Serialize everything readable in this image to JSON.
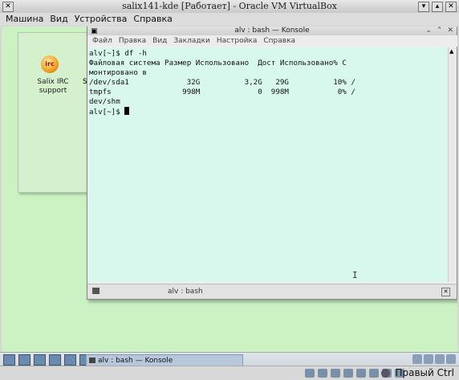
{
  "window": {
    "title": "salix141-kde [Работает] - Oracle VM VirtualBox",
    "controls": [
      "▾",
      "▴",
      "✕"
    ]
  },
  "vb_menu": [
    "Машина",
    "Вид",
    "Устройства",
    "Справка"
  ],
  "desktop_icon": {
    "badge": "irc",
    "label_line1": "Salix IRC",
    "label_line2": "support",
    "peek": "S"
  },
  "konsole": {
    "title": "alv : bash — Konsole",
    "menu": [
      "Файл",
      "Правка",
      "Вид",
      "Закладки",
      "Настройка",
      "Справка"
    ],
    "terminal_lines": [
      "alv[~]$ df -h",
      "Файловая система Размер Использовано  Дост Использовано% С",
      "монтировано в",
      "/dev/sda1             32G          3,2G   29G          10% /",
      "tmpfs                998M             0  998M           0% /",
      "dev/shm"
    ],
    "prompt": "alv[~]$ ",
    "tab_label": "alv : bash"
  },
  "taskbar": {
    "task_label": "alv : bash — Konsole"
  },
  "status": {
    "host_key": "Правый Ctrl"
  }
}
